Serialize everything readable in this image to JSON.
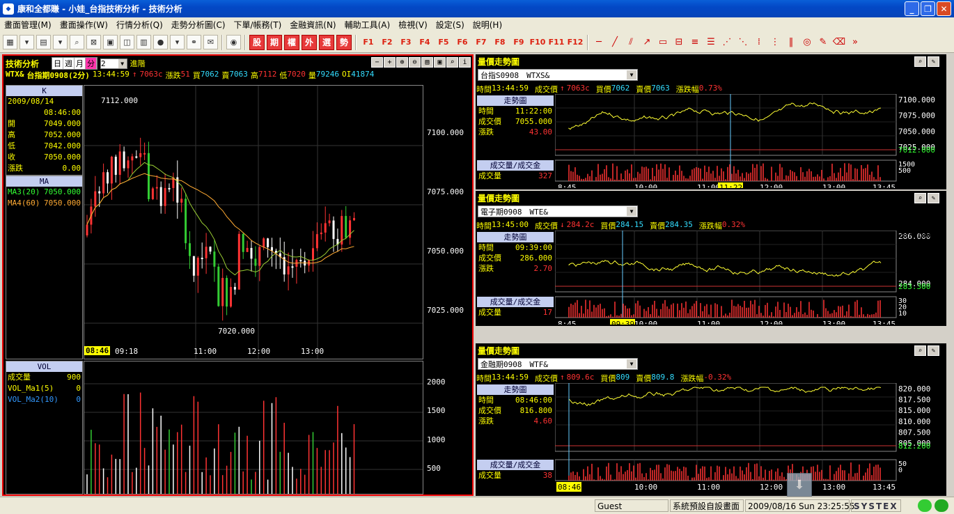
{
  "window": {
    "title": "康和全都賺 - 小娃_台指技術分析 - 技術分析",
    "minimize": "_",
    "restore": "❐",
    "close": "✕"
  },
  "menu": [
    "畫面管理(M)",
    "畫面操作(W)",
    "行情分析(Q)",
    "走勢分析圖(C)",
    "下單/帳務(T)",
    "金融資訊(N)",
    "輔助工具(A)",
    "檢視(V)",
    "設定(S)",
    "說明(H)"
  ],
  "toolbar": {
    "chinese_buttons": [
      "股",
      "期",
      "權",
      "外",
      "選",
      "勢"
    ],
    "fkeys": [
      "F1",
      "F2",
      "F3",
      "F4",
      "F5",
      "F6",
      "F7",
      "F8",
      "F9",
      "F10",
      "F11",
      "F12"
    ]
  },
  "tech": {
    "title": "技術分析",
    "periods": [
      "日",
      "週",
      "月",
      "分"
    ],
    "period_selected": "分",
    "interval": "2",
    "advanced": "進階",
    "quote": {
      "symbol": "WTX&",
      "name": "台指期0908(2分)",
      "time": "13:44:59",
      "arrow": "↑",
      "price": "7063c",
      "chg_label": "漲跌",
      "chg": "51",
      "bid_label": "買",
      "bid": "7062",
      "ask_label": "賣",
      "ask": "7063",
      "high_label": "高",
      "high": "7112",
      "low_label": "低",
      "low": "7020",
      "vol_label": "量",
      "vol": "79246",
      "oi_label": "OI",
      "oi": "41874"
    },
    "k_panel": {
      "head": "K",
      "date": "2009/08/14",
      "time": "08:46:00",
      "rows": [
        {
          "label": "開",
          "value": "7049.000"
        },
        {
          "label": "高",
          "value": "7052.000"
        },
        {
          "label": "低",
          "value": "7042.000"
        },
        {
          "label": "收",
          "value": "7050.000"
        },
        {
          "label": "漲跌",
          "value": "0.00"
        }
      ]
    },
    "ma_panel": {
      "head": "MA",
      "rows": [
        {
          "label": "MA3(20)",
          "value": "7050.000"
        },
        {
          "label": "MA4(60)",
          "value": "7050.000"
        }
      ]
    },
    "vol_panel": {
      "head": "VOL",
      "rows": [
        {
          "label": "成交量",
          "value": "900"
        },
        {
          "label": "VOL_Ma1(5)",
          "value": "0"
        },
        {
          "label": "VOL_Ma2(10)",
          "value": "0"
        }
      ]
    },
    "price_axis": [
      "7100.000",
      "7075.000",
      "7050.000",
      "7025.000"
    ],
    "vol_axis": [
      "2000",
      "1500",
      "1000",
      "500"
    ],
    "time_axis": [
      "09:18",
      "11:00",
      "12:00",
      "13:00"
    ],
    "cursor_time": "08:46",
    "high_mark": "7112.000",
    "low_mark": "7020.000"
  },
  "panels": [
    {
      "title": "量價走勢圖",
      "symbol": "台指S0908　WTXS&",
      "quote": {
        "time_label": "時間",
        "time": "13:44:59",
        "price_label": "成交價",
        "arrow": "↑",
        "price": "7063c",
        "bid_label": "買價",
        "bid": "7062",
        "ask_label": "賣價",
        "ask": "7063",
        "pct_label": "漲跌幅",
        "pct": "0.73%"
      },
      "chart_label": "走勢圖",
      "rows": [
        {
          "label": "時間",
          "value": "11:22:00"
        },
        {
          "label": "成交價",
          "value": "7055.000"
        },
        {
          "label": "漲跌",
          "value": "43.00"
        }
      ],
      "vol_label": "成交量/成交金",
      "vol_row": {
        "label": "成交量",
        "value": "327"
      },
      "axis": [
        "7100.000",
        "7075.000",
        "7050.000",
        "7025.000"
      ],
      "last": "7012.000",
      "vaxis": [
        "1500",
        "500"
      ],
      "times": [
        "8:45",
        "10:00",
        "11:00",
        "12:00",
        "13:00",
        "13:45"
      ],
      "cursor": "11:22"
    },
    {
      "title": "量價走勢圖",
      "symbol": "電子期0908　WTE&",
      "quote": {
        "time_label": "時間",
        "time": "13:45:00",
        "price_label": "成交價",
        "arrow": "↓",
        "price": "284.2c",
        "bid_label": "買價",
        "bid": "284.15",
        "ask_label": "賣價",
        "ask": "284.35",
        "pct_label": "漲跌幅",
        "pct": "0.32%"
      },
      "chart_label": "走勢圖",
      "rows": [
        {
          "label": "時間",
          "value": "09:39:00"
        },
        {
          "label": "成交價",
          "value": "286.000"
        },
        {
          "label": "漲跌",
          "value": "2.70"
        }
      ],
      "vol_label": "成交量/成交金",
      "vol_row": {
        "label": "成交量",
        "value": "17"
      },
      "axis": [
        "286.000",
        "284.000"
      ],
      "last": "283.300",
      "top": "287.186",
      "vaxis": [
        "30",
        "20",
        "10"
      ],
      "times": [
        "8:45",
        "10:00",
        "11:00",
        "12:00",
        "13:00",
        "13:45"
      ],
      "cursor": "09:39"
    },
    {
      "title": "量價走勢圖",
      "symbol": "金融期0908　WTF&",
      "quote": {
        "time_label": "時間",
        "time": "13:44:59",
        "price_label": "成交價",
        "arrow": "↑",
        "price": "809.6c",
        "bid_label": "買價",
        "bid": "809",
        "ask_label": "賣價",
        "ask": "809.8",
        "pct_label": "漲跌幅",
        "pct": "-0.32%"
      },
      "chart_label": "走勢圖",
      "rows": [
        {
          "label": "時間",
          "value": "08:46:00"
        },
        {
          "label": "成交價",
          "value": "816.800"
        },
        {
          "label": "漲跌",
          "value": "4.60"
        }
      ],
      "vol_label": "成交量/成交金",
      "vol_row": {
        "label": "成交量",
        "value": "38"
      },
      "axis": [
        "820.000",
        "817.500",
        "815.000",
        "810.000",
        "807.500",
        "805.000"
      ],
      "last": "812.200",
      "vaxis": [
        "50",
        "0"
      ],
      "times": [
        "8:",
        "10:00",
        "11:00",
        "12:00",
        "13:00",
        "13:45"
      ],
      "cursor": "08:46"
    }
  ],
  "status": {
    "user": "Guest",
    "screen": "系統預設自設畫面",
    "datetime": "2009/08/16 Sun 23:25:55",
    "brand": "SYSTEX"
  },
  "colors": {
    "accent": "#ffff00",
    "up": "#ff3333",
    "frame": "#ee0000"
  }
}
